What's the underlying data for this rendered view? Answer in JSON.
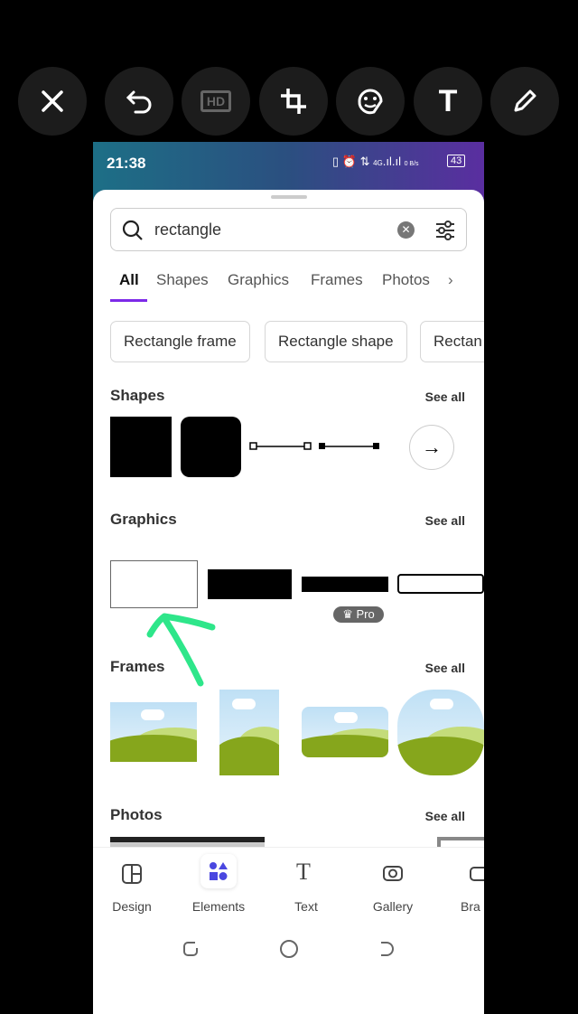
{
  "toolbar": {
    "buttons": [
      "close-icon",
      "undo-icon",
      "hd-icon",
      "crop-rotate-icon",
      "sticker-icon",
      "text-icon",
      "pencil-icon"
    ],
    "hd_label": "HD",
    "text_label": "T"
  },
  "status": {
    "time": "21:38",
    "network": "4G",
    "speed": "0 B/s",
    "battery": "43"
  },
  "search": {
    "value": "rectangle"
  },
  "tabs": [
    "All",
    "Shapes",
    "Graphics",
    "Frames",
    "Photos"
  ],
  "chips": [
    "Rectangle frame",
    "Rectangle shape",
    "Rectan"
  ],
  "sections": {
    "shapes": "Shapes",
    "graphics": "Graphics",
    "frames": "Frames",
    "photos": "Photos",
    "see_all": "See all"
  },
  "pro_badge": "Pro",
  "annotation_color": "#2ee68a",
  "accent": "#7d2ae8",
  "bottom_nav": [
    {
      "label": "Design"
    },
    {
      "label": "Elements"
    },
    {
      "label": "Text"
    },
    {
      "label": "Gallery"
    },
    {
      "label": "Bra"
    }
  ]
}
